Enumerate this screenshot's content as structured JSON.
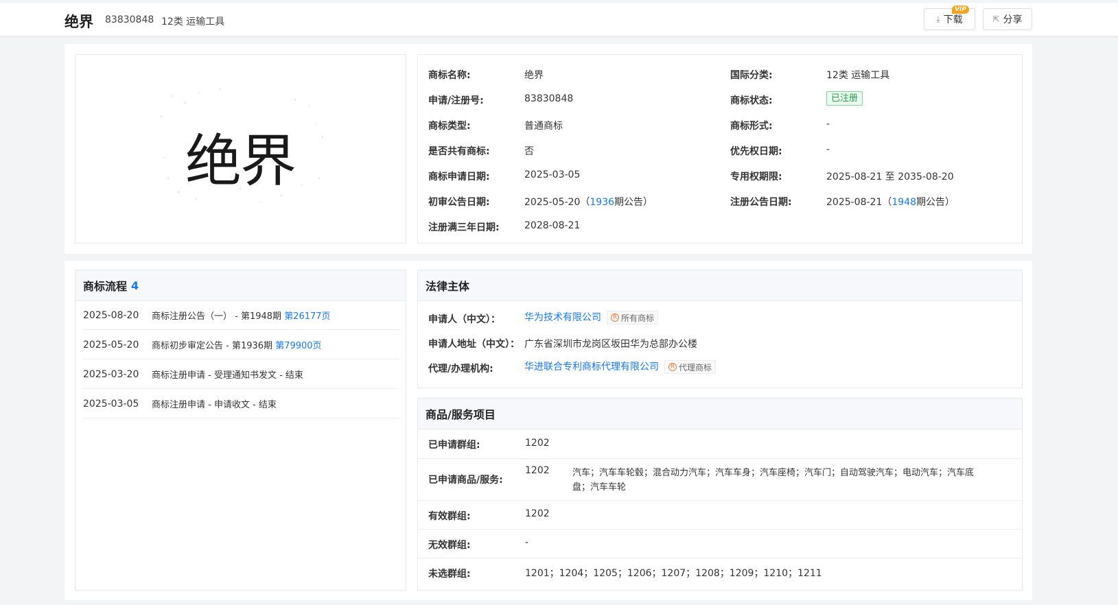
{
  "header": {
    "title": "绝界",
    "reg_no": "83830848",
    "class": "12类 运输工具",
    "download_label": "下载",
    "vip_badge": "VIP",
    "share_label": "分享"
  },
  "mark_image": {
    "text": "绝界"
  },
  "info": {
    "name": {
      "label": "商标名称:",
      "value": "绝界"
    },
    "intl_class": {
      "label": "国际分类:",
      "value": "12类 运输工具"
    },
    "reg_no": {
      "label": "申请/注册号:",
      "value": "83830848"
    },
    "status": {
      "label": "商标状态:",
      "value": "已注册"
    },
    "type": {
      "label": "商标类型:",
      "value": "普通商标"
    },
    "form": {
      "label": "商标形式:",
      "value": "-"
    },
    "shared": {
      "label": "是否共有商标:",
      "value": "否"
    },
    "priority_date": {
      "label": "优先权日期:",
      "value": "-"
    },
    "apply_date": {
      "label": "商标申请日期:",
      "value": "2025-03-05"
    },
    "exclusive_period": {
      "label": "专用权期限:",
      "value": "2025-08-21 至 2035-08-20"
    },
    "prelim_date": {
      "label": "初审公告日期:",
      "date": "2025-05-20",
      "open": "（",
      "issue": "1936",
      "close": "期公告）"
    },
    "reg_pub_date": {
      "label": "注册公告日期:",
      "date": "2025-08-21",
      "open": "（",
      "issue": "1948",
      "close": "期公告）"
    },
    "three_year": {
      "label": "注册满三年日期:",
      "value": "2028-08-21"
    }
  },
  "flow": {
    "title": "商标流程",
    "count": "4",
    "items": [
      {
        "date": "2025-08-20",
        "text": "商标注册公告（一） - 第1948期 ",
        "link": "第26177页"
      },
      {
        "date": "2025-05-20",
        "text": "商标初步审定公告 - 第1936期 ",
        "link": "第79900页"
      },
      {
        "date": "2025-03-20",
        "text": "商标注册申请 - 受理通知书发文 - 结束",
        "link": ""
      },
      {
        "date": "2025-03-05",
        "text": "商标注册申请 - 申请收文 - 结束",
        "link": ""
      }
    ]
  },
  "legal": {
    "title": "法律主体",
    "applicant": {
      "label": "申请人（中文）：",
      "value": "华为技术有限公司",
      "tag": "所有商标",
      "tag_icon": "R"
    },
    "address": {
      "label": "申请人地址（中文）：",
      "value": "广东省深圳市龙岗区坂田华为总部办公楼"
    },
    "agent": {
      "label": "代理/办理机构:",
      "value": "华进联合专利商标代理有限公司",
      "tag": "代理商标",
      "tag_icon": "R"
    }
  },
  "goods": {
    "title": "商品/服务项目",
    "applied_group": {
      "label": "已申请群组:",
      "value": "1202"
    },
    "applied_goods": {
      "label": "已申请商品/服务:",
      "group": "1202",
      "items_line1": "汽车；汽车车轮毂；混合动力汽车；汽车车身；汽车座椅；汽车门；自动驾驶汽车；电动汽车；汽车底",
      "items_line2": "盘；汽车车轮"
    },
    "valid_group": {
      "label": "有效群组:",
      "value": "1202"
    },
    "invalid_group": {
      "label": "无效群组:",
      "value": "-"
    },
    "unselected_group": {
      "label": "未选群组:",
      "value": "1201；1204；1205；1206；1207；1208；1209；1210；1211"
    }
  },
  "colors": {
    "link": "#1677ff",
    "status_green": "#22a34a",
    "tag_orange": "#f07a3a",
    "vip": "#f7a21b"
  }
}
